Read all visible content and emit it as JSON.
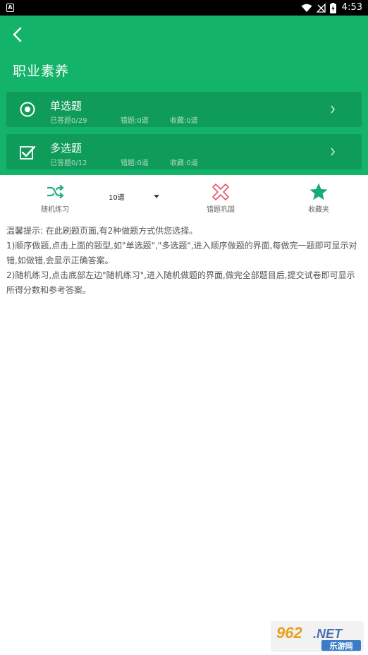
{
  "status_bar": {
    "notification_icon": "A",
    "time": "4:53"
  },
  "page": {
    "title": "职业素养"
  },
  "question_types": [
    {
      "name": "单选题",
      "icon": "radio-target-icon",
      "answered": "已答题0/29",
      "wrong": "错题:0道",
      "favorites": "收藏:0道"
    },
    {
      "name": "多选题",
      "icon": "checkbox-check-icon",
      "answered": "已答题0/12",
      "wrong": "错题:0道",
      "favorites": "收藏:0道"
    }
  ],
  "toolbar": {
    "random_practice": "随机练习",
    "count_selected": "10道",
    "wrong_review": "错题巩固",
    "favorites": "收藏夹"
  },
  "tips": {
    "line1": "温馨提示:  在此刷题页面,有2种做题方式供您选择。",
    "line2": "1)顺序做题,点击上面的题型,如\"单选题\",\"多选题\",进入顺序做题的界面,每做完一题即可显示对错,如做错,会显示正确答案。",
    "line3": "2)随机练习,点击底部左边\"随机练习\",进入随机做题的界面,做完全部题目后,提交试卷即可显示所得分数和参考答案。"
  },
  "watermark": {
    "brand": "962.NET",
    "sub": "乐游网"
  },
  "colors": {
    "header_green": "#14b36a",
    "card_green": "#0f9b59",
    "accent_teal": "#22b07a",
    "wrong_red": "#e06070",
    "star_teal": "#1aaa7a"
  }
}
